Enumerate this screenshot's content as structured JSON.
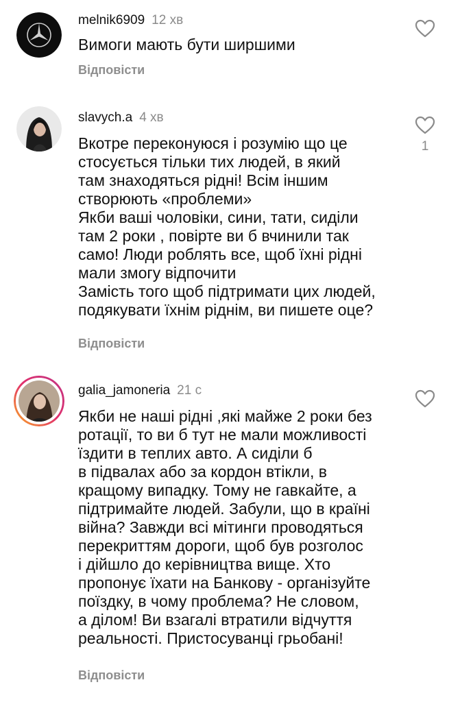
{
  "comments": [
    {
      "username": "melnik6909",
      "time": "12 хв",
      "text": "Вимоги мають бути ширшими",
      "reply": "Відповісти"
    },
    {
      "username": "slavych.a",
      "time": "4 хв",
      "text": "Вкотре переконуюся і розумію що це\nстосується тільки тих людей, в який\nтам знаходяться рідні! Всім іншим\nстворюють «проблеми»\nЯкби ваші чоловіки, сини, тати, сиділи\nтам 2 роки , повірте ви б вчинили так\nсамо! Люди роблять все, щоб їхні рідні\nмали змогу відпочити\nЗамість того щоб підтримати цих людей,\nподякувати їхнім ріднім, ви пишете оце?",
      "reply": "Відповісти",
      "likes": "1"
    },
    {
      "username": "galia_jamoneria",
      "time": "21 с",
      "text": "Якби не наші рідні ,які майже 2 роки без\nротації,  то ви б тут не мали можливості\nїздити в теплих авто.  А сиділи б\nв підвалах або за кордон втікли, в\nкращому випадку. Тому не гавкайте, а\nпідтримайте людей. Забули, що в країні\nвійна? Завжди всі мітинги проводяться\nперекриттям дороги, щоб був розголос\nі дійшло до керівництва вище. Хто\nпропонує їхати на Банкову - організуйте\nпоїздку, в чому проблема? Не словом,\nа ділом! Ви взагалі втратили відчуття\nреальності. Пристосуванці грьобані!",
      "reply": "Відповісти"
    }
  ],
  "icons": {
    "like": "heart-outline-icon"
  },
  "colors": {
    "meta_gray": "#8e8e8e",
    "story_ring": [
      "#f9a825",
      "#e1306c",
      "#c13584"
    ]
  }
}
